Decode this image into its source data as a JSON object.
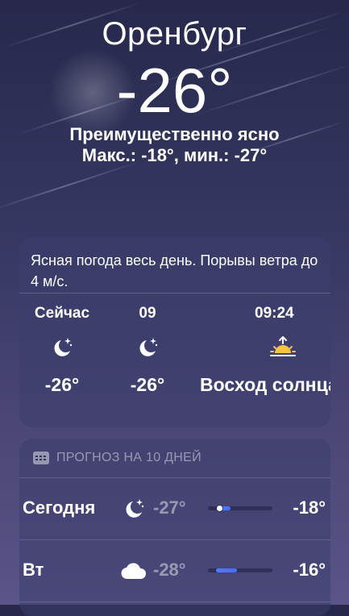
{
  "location": {
    "city": "Оренбург",
    "temperature": "-26°",
    "condition": "Преимущественно ясно",
    "hi_lo": "Макс.: -18°, мин.: -27°"
  },
  "hourly_card": {
    "summary": "Ясная погода весь день. Порывы ветра до 4 м/с.",
    "hours": [
      {
        "label": "Сейчас",
        "icon": "moon-stars-icon",
        "temp": "-26°"
      },
      {
        "label": "09",
        "icon": "moon-stars-icon",
        "temp": "-26°"
      },
      {
        "label": "09:24",
        "icon": "sunrise-icon",
        "temp": "Восход солнца"
      }
    ]
  },
  "forecast": {
    "header_icon": "calendar-icon",
    "header": "ПРОГНОЗ НА 10 ДНЕЙ",
    "days": [
      {
        "day": "Сегодня",
        "icon": "moon-stars-icon",
        "low": "-27°",
        "high": "-18°",
        "range_start": 0.18,
        "range_end": 0.35,
        "current": 0.18
      },
      {
        "day": "Вт",
        "icon": "cloud-icon",
        "low": "-28°",
        "high": "-16°",
        "range_start": 0.12,
        "range_end": 0.45
      }
    ]
  },
  "colors": {
    "bar_fill": "#4f7cff",
    "sun": "#f5c242"
  }
}
